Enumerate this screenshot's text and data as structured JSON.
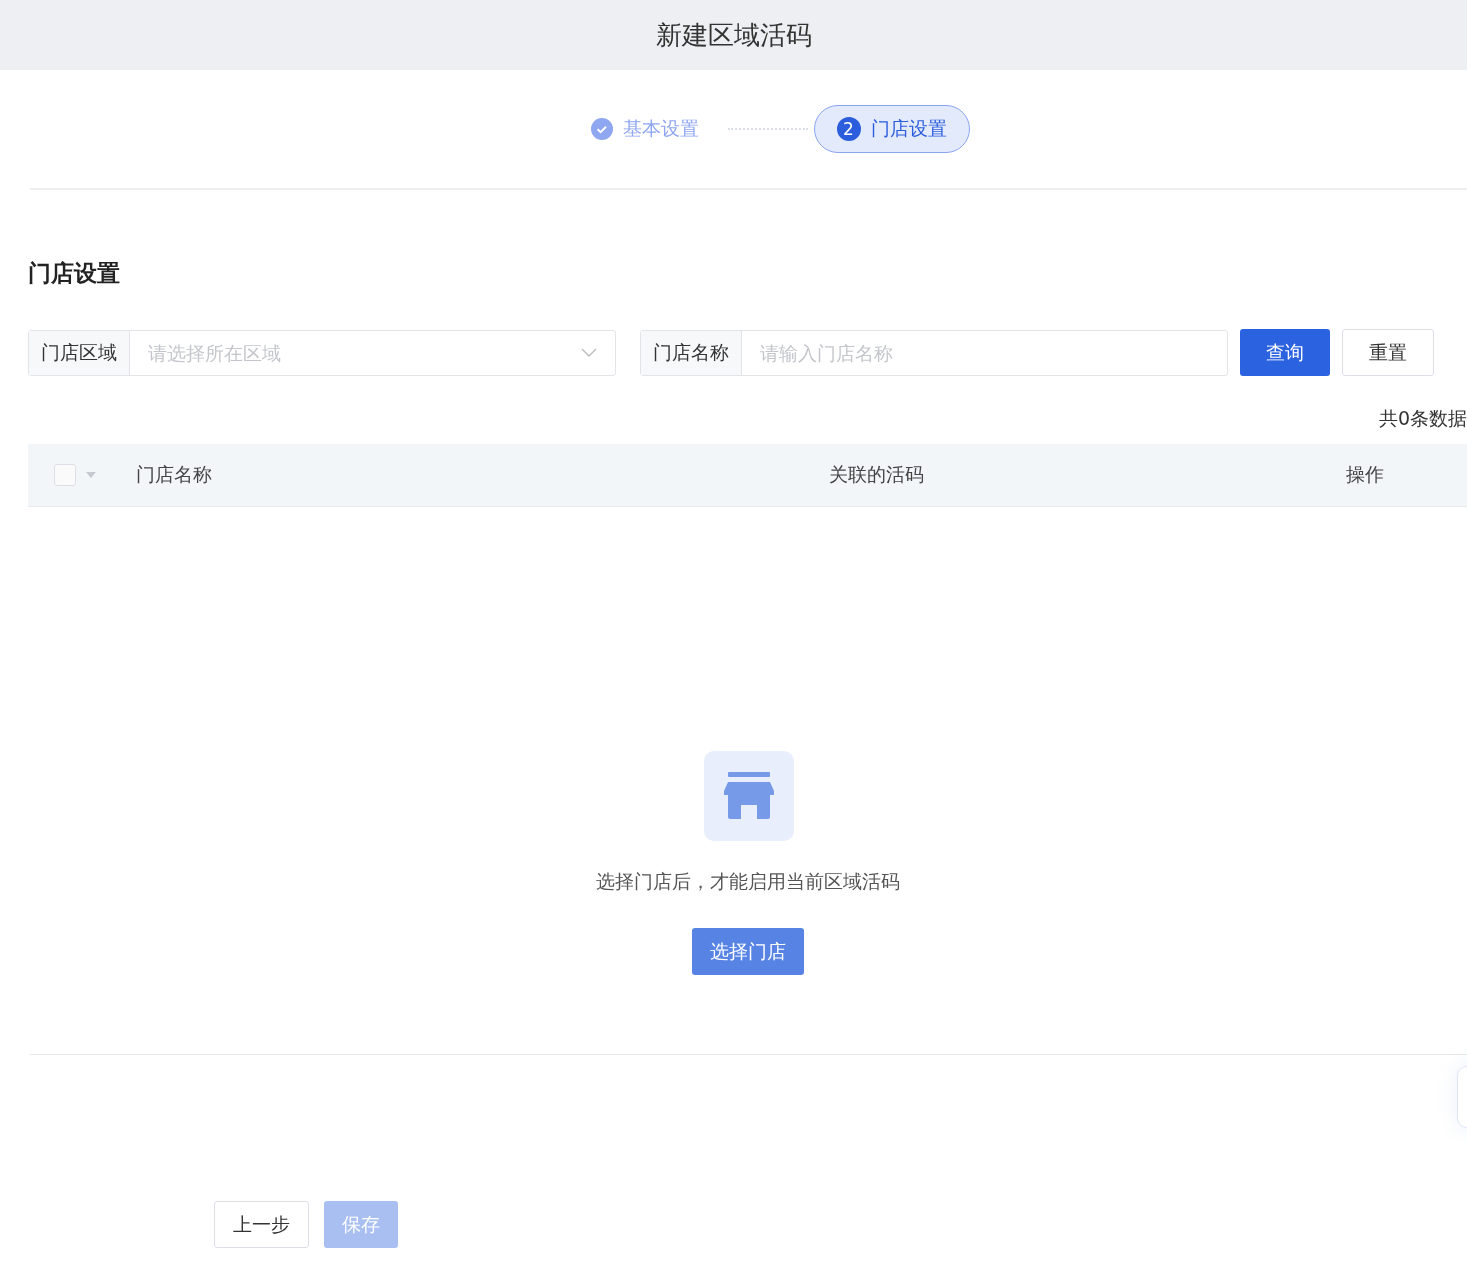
{
  "window": {
    "title": "新建区域活码"
  },
  "steps": [
    {
      "kind": "done",
      "label": "基本设置",
      "selected": false
    },
    {
      "kind": "current",
      "number": "2",
      "label": "门店设置",
      "selected": true
    }
  ],
  "section": {
    "title": "门店设置"
  },
  "filters": [
    {
      "kind": "select",
      "label": "门店区域",
      "placeholder": "请选择所在区域"
    },
    {
      "kind": "text",
      "label": "门店名称",
      "placeholder": "请输入门店名称"
    }
  ],
  "filter_buttons": [
    {
      "kind": "primary",
      "label": "查询"
    },
    {
      "kind": "default",
      "label": "重置"
    }
  ],
  "total": "共0条数据",
  "table": {
    "select_all": {
      "checked": false
    },
    "columns": [
      "门店名称",
      "关联的活码",
      "操作"
    ]
  },
  "empty": {
    "message": "选择门店后，才能启用当前区域活码",
    "button": "选择门店"
  },
  "footer_buttons": [
    {
      "kind": "default",
      "label": "上一步",
      "disabled": false
    },
    {
      "kind": "primary",
      "label": "保存",
      "disabled": true
    }
  ]
}
